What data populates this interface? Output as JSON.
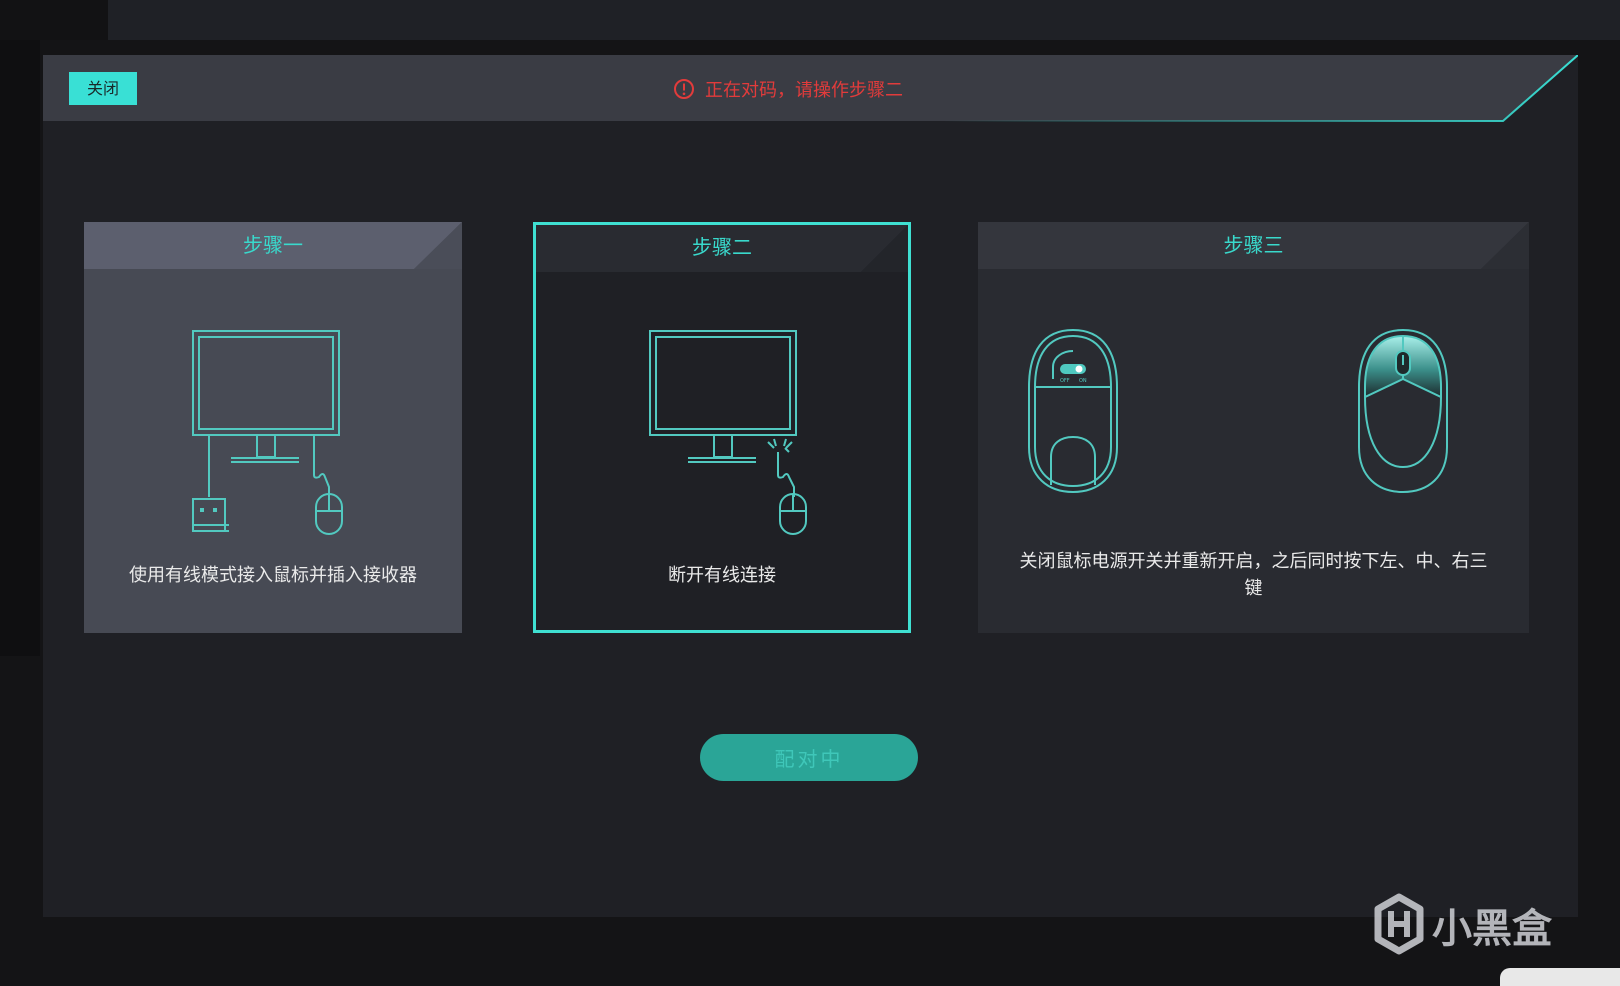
{
  "window": {
    "minimize_icon": "minimize-icon",
    "close_icon": "close-icon"
  },
  "dialog": {
    "close_label": "关闭",
    "status_text": "正在对码，请操作步骤二",
    "status_icon": "alert-circle-icon",
    "status_color": "#e23b3b",
    "accent_color": "#39e0d5"
  },
  "steps": [
    {
      "title": "步骤一",
      "description": "使用有线模式接入鼠标并插入接收器",
      "illustration": "monitor-with-wired-mouse-and-receiver"
    },
    {
      "title": "步骤二",
      "description": "断开有线连接",
      "illustration": "monitor-with-disconnected-mouse",
      "active": true
    },
    {
      "title": "步骤三",
      "description": "关闭鼠标电源开关并重新开启，之后同时按下左、中、右三键",
      "illustration": "mouse-power-switch-and-three-buttons",
      "switch_off_label": "OFF",
      "switch_on_label": "ON"
    }
  ],
  "pair_button_label": "配对中",
  "watermark": {
    "text": "小黑盒",
    "logo_icon": "xiaoheihe-logo-icon"
  }
}
